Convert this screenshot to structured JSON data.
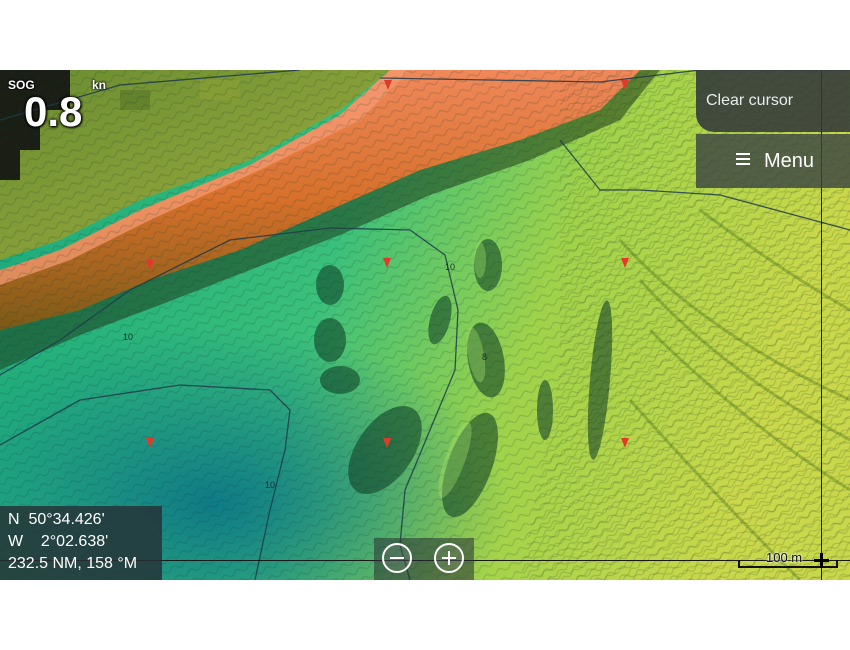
{
  "sog": {
    "label": "SOG",
    "unit": "kn",
    "value": "0.8"
  },
  "buttons": {
    "clear_cursor": "Clear cursor",
    "menu": "Menu"
  },
  "position": {
    "lat": "N  50°34.426'",
    "lon": "W    2°02.638'",
    "range_bearing": "232.5 NM, 158 °M"
  },
  "scale": {
    "label": "100 m"
  },
  "depth_labels": [
    "10",
    "10",
    "8",
    "10"
  ],
  "colors": {
    "shallow_red": "#e0603a",
    "deep_green": "#1fa87a",
    "contour": "#1d3b4a",
    "overlay_panel": "#323a3c"
  }
}
